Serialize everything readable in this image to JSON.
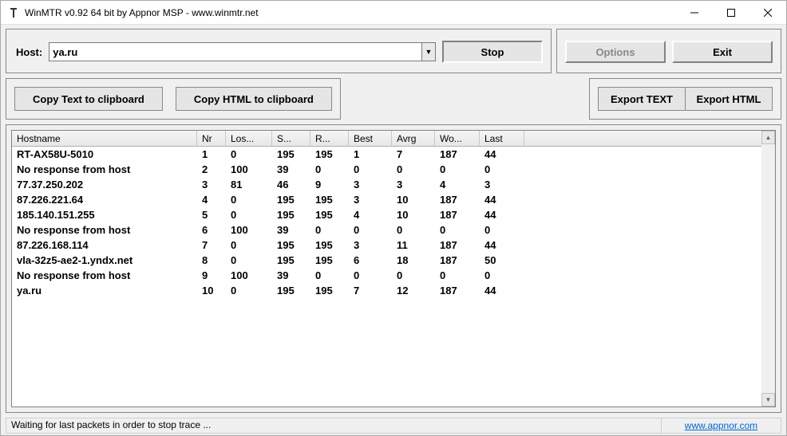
{
  "window": {
    "title": "WinMTR v0.92 64 bit by Appnor MSP - www.winmtr.net"
  },
  "hostrow": {
    "label": "Host:",
    "value": "ya.ru",
    "stop_label": "Stop",
    "options_label": "Options",
    "exit_label": "Exit"
  },
  "toolbar": {
    "copy_text": "Copy Text to clipboard",
    "copy_html": "Copy HTML to clipboard",
    "export_text": "Export TEXT",
    "export_html": "Export HTML"
  },
  "grid": {
    "columns": [
      "Hostname",
      "Nr",
      "Los...",
      "S...",
      "R...",
      "Best",
      "Avrg",
      "Wo...",
      "Last"
    ],
    "rows": [
      [
        "RT-AX58U-5010",
        "1",
        "0",
        "195",
        "195",
        "1",
        "7",
        "187",
        "44"
      ],
      [
        "No response from host",
        "2",
        "100",
        "39",
        "0",
        "0",
        "0",
        "0",
        "0"
      ],
      [
        "77.37.250.202",
        "3",
        "81",
        "46",
        "9",
        "3",
        "3",
        "4",
        "3"
      ],
      [
        "87.226.221.64",
        "4",
        "0",
        "195",
        "195",
        "3",
        "10",
        "187",
        "44"
      ],
      [
        "185.140.151.255",
        "5",
        "0",
        "195",
        "195",
        "4",
        "10",
        "187",
        "44"
      ],
      [
        "No response from host",
        "6",
        "100",
        "39",
        "0",
        "0",
        "0",
        "0",
        "0"
      ],
      [
        "87.226.168.114",
        "7",
        "0",
        "195",
        "195",
        "3",
        "11",
        "187",
        "44"
      ],
      [
        "vla-32z5-ae2-1.yndx.net",
        "8",
        "0",
        "195",
        "195",
        "6",
        "18",
        "187",
        "50"
      ],
      [
        "No response from host",
        "9",
        "100",
        "39",
        "0",
        "0",
        "0",
        "0",
        "0"
      ],
      [
        "ya.ru",
        "10",
        "0",
        "195",
        "195",
        "7",
        "12",
        "187",
        "44"
      ]
    ]
  },
  "status": {
    "text": "Waiting for last packets in order to stop trace ...",
    "link": "www.appnor.com"
  }
}
